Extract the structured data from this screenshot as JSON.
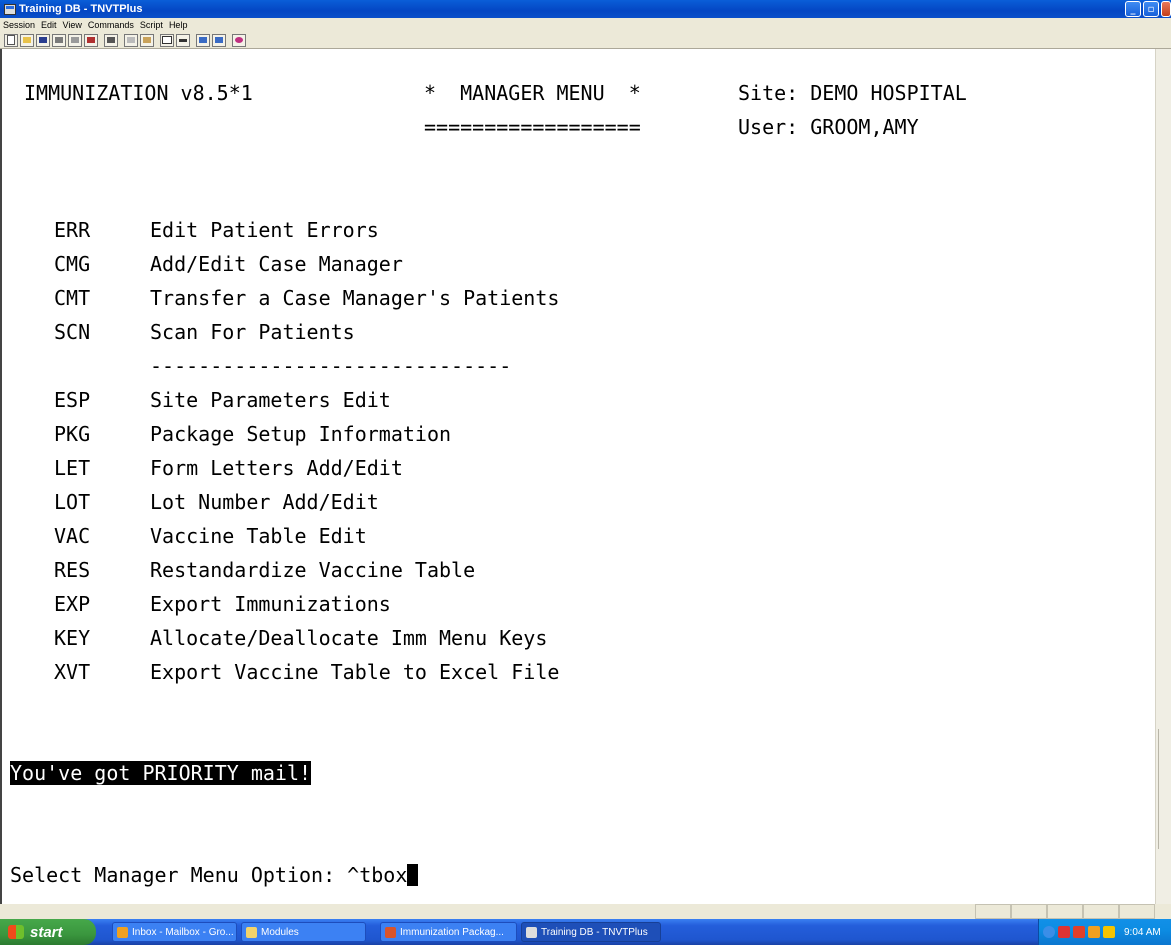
{
  "window": {
    "title": "Training DB - TNVTPlus",
    "menu": [
      "Session",
      "Edit",
      "View",
      "Commands",
      "Script",
      "Help"
    ]
  },
  "terminal": {
    "header": {
      "app": "IMMUNIZATION v8.5*1",
      "menu_title": "*  MANAGER MENU  *",
      "underline": "==================",
      "site": "Site: DEMO HOSPITAL",
      "user": "User: GROOM,AMY"
    },
    "options_group1": [
      {
        "code": "ERR",
        "label": "Edit Patient Errors"
      },
      {
        "code": "CMG",
        "label": "Add/Edit Case Manager"
      },
      {
        "code": "CMT",
        "label": "Transfer a Case Manager's Patients"
      },
      {
        "code": "SCN",
        "label": "Scan For Patients"
      }
    ],
    "separator": "------------------------------",
    "options_group2": [
      {
        "code": "ESP",
        "label": "Site Parameters Edit"
      },
      {
        "code": "PKG",
        "label": "Package Setup Information"
      },
      {
        "code": "LET",
        "label": "Form Letters Add/Edit"
      },
      {
        "code": "LOT",
        "label": "Lot Number Add/Edit"
      },
      {
        "code": "VAC",
        "label": "Vaccine Table Edit"
      },
      {
        "code": "RES",
        "label": "Restandardize Vaccine Table"
      },
      {
        "code": "EXP",
        "label": "Export Immunizations"
      },
      {
        "code": "KEY",
        "label": "Allocate/Deallocate Imm Menu Keys"
      },
      {
        "code": "XVT",
        "label": "Export Vaccine Table to Excel File"
      }
    ],
    "mail_notice": "You've got PRIORITY mail!",
    "prompt": "Select Manager Menu Option: ",
    "input_value": "^tbox"
  },
  "taskbar": {
    "start_label": "start",
    "tasks": [
      {
        "label": "Inbox - Mailbox - Gro...",
        "icon": "outlook-icon",
        "color": "#f0a020"
      },
      {
        "label": "Modules",
        "icon": "folder-icon",
        "color": "#f3d36b"
      },
      {
        "label": "Immunization Packag...",
        "icon": "powerpoint-icon",
        "color": "#d9542b"
      },
      {
        "label": "Training DB - TNVTPlus",
        "icon": "terminal-icon",
        "color": "#dddddd"
      }
    ],
    "clock": "9:04 AM"
  },
  "colors": {
    "titlebar": "#0a5ed8",
    "taskbar": "#245edb",
    "start": "#3a963e",
    "highlight_bg": "#000000"
  }
}
